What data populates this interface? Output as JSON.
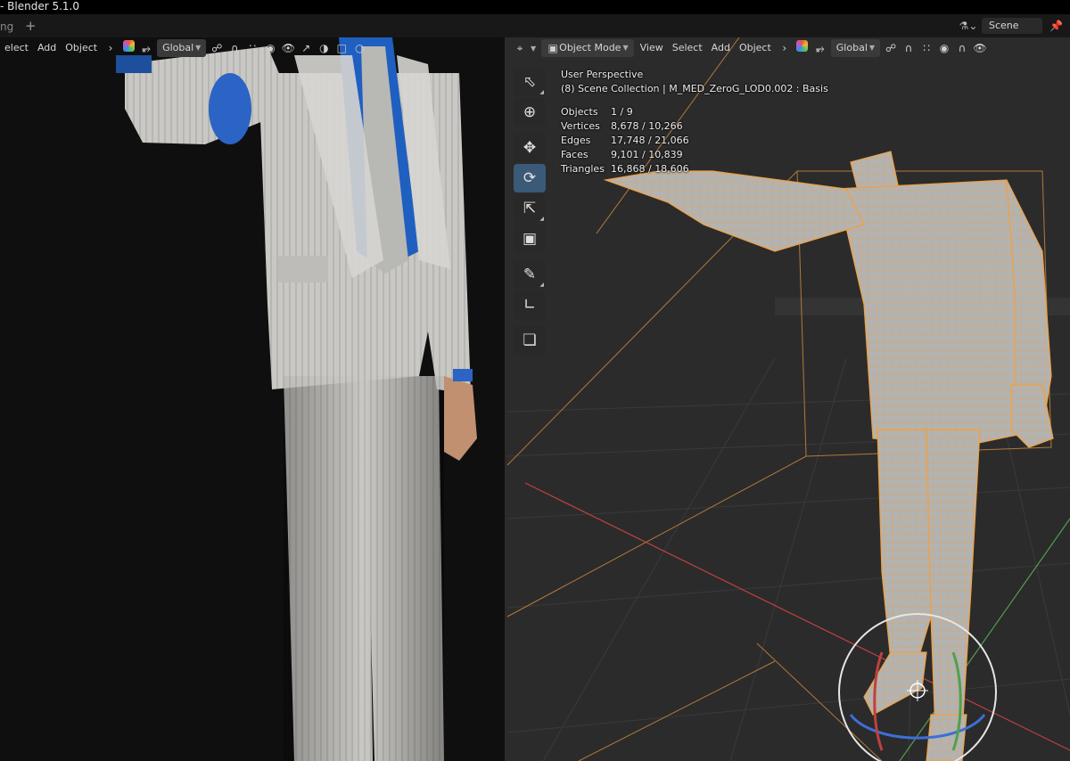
{
  "titlebar": {
    "title": "- Blender 5.1.0"
  },
  "tabs": {
    "active_fragment": "ng",
    "add": "+"
  },
  "scene": {
    "icon": "scene-icon",
    "label": "Scene",
    "pin": "pin-icon"
  },
  "left_viewport": {
    "menu": [
      "elect",
      "Add",
      "Object"
    ],
    "transform_orientation": "Global"
  },
  "right_viewport": {
    "mode": "Object Mode",
    "menu": [
      "View",
      "Select",
      "Add",
      "Object"
    ],
    "transform_orientation": "Global",
    "overlay": {
      "perspective": "User Perspective",
      "collection": "(8) Scene Collection | M_MED_ZeroG_LOD0.002 : Basis"
    },
    "stats": [
      {
        "label": "Objects",
        "value": "1 / 9"
      },
      {
        "label": "Vertices",
        "value": "8,678 / 10,266"
      },
      {
        "label": "Edges",
        "value": "17,748 / 21,066"
      },
      {
        "label": "Faces",
        "value": "9,101 / 10,839"
      },
      {
        "label": "Triangles",
        "value": "16,868 / 18,606"
      }
    ],
    "tools": [
      "select-box-icon",
      "cursor-icon",
      "move-icon",
      "rotate-icon",
      "scale-icon",
      "transform-icon",
      "annotate-icon",
      "measure-icon",
      "add-cube-icon"
    ],
    "active_tool": "rotate-icon"
  },
  "colors": {
    "selection_outline": "#f0a040",
    "wire": "#e8a050",
    "axis_x": "#c04040",
    "axis_y": "#50a050",
    "suit": "#c8c8c6",
    "shirt": "#2060c0"
  }
}
